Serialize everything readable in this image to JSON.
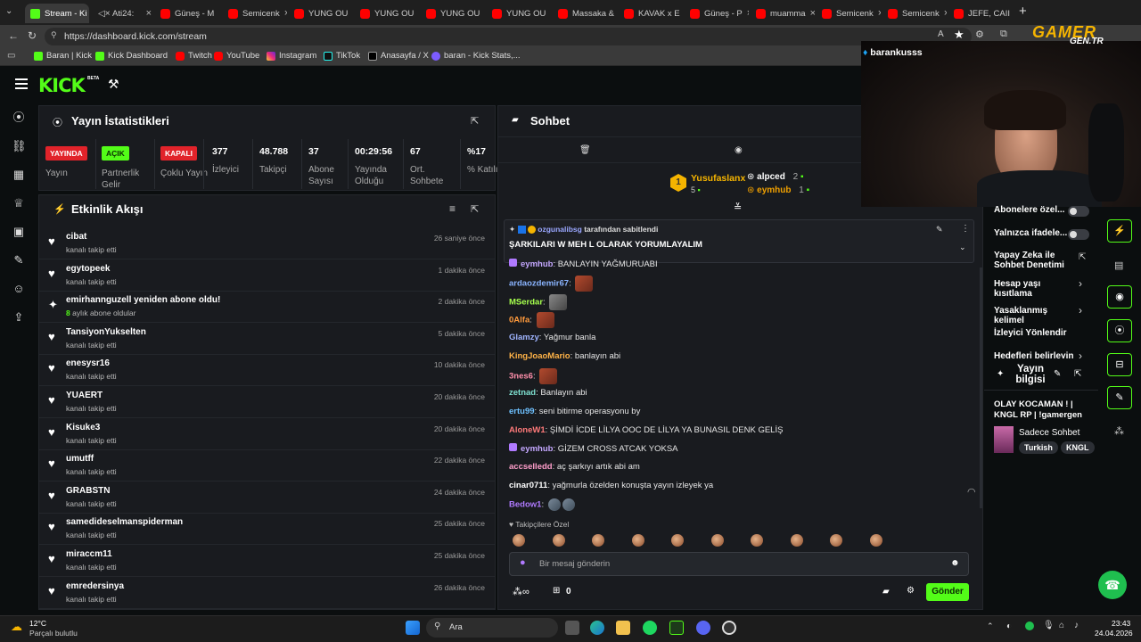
{
  "browser": {
    "tabs": [
      {
        "label": "Stream - Ki",
        "icon": "kick-favicon",
        "active": true
      },
      {
        "label": "Ati24:",
        "icon": "mute-icon"
      },
      {
        "label": "Güneş - M",
        "icon": "youtube-favicon"
      },
      {
        "label": "Semicenk",
        "icon": "youtube-favicon"
      },
      {
        "label": "YUNG OU",
        "icon": "youtube-favicon"
      },
      {
        "label": "YUNG OU",
        "icon": "youtube-favicon"
      },
      {
        "label": "YUNG OU",
        "icon": "youtube-favicon"
      },
      {
        "label": "YUNG OU",
        "icon": "youtube-favicon"
      },
      {
        "label": "Massaka &",
        "icon": "youtube-favicon"
      },
      {
        "label": "KAVAK x E",
        "icon": "youtube-favicon"
      },
      {
        "label": "Güneş - P",
        "icon": "youtube-favicon"
      },
      {
        "label": "muamma",
        "icon": "youtube-favicon"
      },
      {
        "label": "Semicenk",
        "icon": "youtube-favicon"
      },
      {
        "label": "Semicenk",
        "icon": "youtube-favicon"
      },
      {
        "label": "JEFE, CAII",
        "icon": "youtube-favicon"
      }
    ],
    "url": "https://dashboard.kick.com/stream",
    "bookmarks": [
      {
        "label": "Baran | Kick",
        "icon": "kick-favicon"
      },
      {
        "label": "Kick Dashboard",
        "icon": "kick-favicon"
      },
      {
        "label": "Twitch",
        "icon": "youtube-favicon"
      },
      {
        "label": "YouTube",
        "icon": "youtube-favicon"
      },
      {
        "label": "Instagram",
        "icon": "instagram-favicon"
      },
      {
        "label": "TikTok",
        "icon": "tiktok-favicon"
      },
      {
        "label": "Anasayfa / X",
        "icon": "x-favicon"
      },
      {
        "label": "baran - Kick Stats,...",
        "icon": "stats-favicon"
      }
    ]
  },
  "kick": {
    "logo": "KICK",
    "logo_badge": "BETA"
  },
  "stats_panel": {
    "title": "Yayın İstatistikleri",
    "statuses": [
      {
        "badge": "YAYINDA",
        "label": "Yayın",
        "color": "#e1232a"
      },
      {
        "badge": "AÇIK",
        "label": "Partnerlik Gelir",
        "color": "#53fc18"
      },
      {
        "badge": "KAPALI",
        "label": "Çoklu Yayın",
        "color": "#e1232a"
      }
    ],
    "metrics": [
      {
        "value": "377",
        "label": "İzleyici"
      },
      {
        "value": "48.788",
        "label": "Takipçi"
      },
      {
        "value": "37",
        "label": "Abone Sayısı"
      },
      {
        "value": "00:29:56",
        "label": "Yayında Olduğu"
      },
      {
        "value": "67",
        "label": "Ort. Sohbete"
      },
      {
        "value": "%17",
        "label": "% Katılım"
      }
    ]
  },
  "activity": {
    "title": "Etkinlik Akışı",
    "items": [
      {
        "name": "cibat",
        "sub": "kanalı takip etti",
        "time": "26 saniye önce",
        "icon": "heart-icon"
      },
      {
        "name": "egytopeek",
        "sub": "kanalı takip etti",
        "time": "1 dakika önce",
        "icon": "heart-icon"
      },
      {
        "name": "emirhannguzell yeniden abone oldu!",
        "sub_num": "8",
        "sub": "aylık abone oldular",
        "time": "2 dakika önce",
        "icon": "star-icon"
      },
      {
        "name": "TansiyonYukselten",
        "sub": "kanalı takip etti",
        "time": "5 dakika önce",
        "icon": "heart-icon"
      },
      {
        "name": "enesysr16",
        "sub": "kanalı takip etti",
        "time": "10 dakika önce",
        "icon": "heart-icon"
      },
      {
        "name": "YUAERT",
        "sub": "kanalı takip etti",
        "time": "20 dakika önce",
        "icon": "heart-icon"
      },
      {
        "name": "Kisuke3",
        "sub": "kanalı takip etti",
        "time": "20 dakika önce",
        "icon": "heart-icon"
      },
      {
        "name": "umutff",
        "sub": "kanalı takip etti",
        "time": "22 dakika önce",
        "icon": "heart-icon"
      },
      {
        "name": "GRABSTN",
        "sub": "kanalı takip etti",
        "time": "24 dakika önce",
        "icon": "heart-icon"
      },
      {
        "name": "samedideselmanspiderman",
        "sub": "kanalı takip etti",
        "time": "25 dakika önce",
        "icon": "heart-icon"
      },
      {
        "name": "miraccm11",
        "sub": "kanalı takip etti",
        "time": "25 dakika önce",
        "icon": "heart-icon"
      },
      {
        "name": "emredersinya",
        "sub": "kanalı takip etti",
        "time": "26 dakika önce",
        "icon": "heart-icon"
      }
    ]
  },
  "chat": {
    "title": "Sohbet",
    "leaderboard": {
      "first": {
        "rank": "1",
        "name": "Yusufaslanx",
        "count": "5"
      },
      "others": [
        {
          "name": "alpced",
          "count": "2"
        },
        {
          "name": "eymhub",
          "count": "1"
        }
      ]
    },
    "pinned": {
      "by_user": "ozgunalibsg",
      "by_text": "tarafından sabitlendi",
      "text": "ŞARKILARI W MEH L OLARAK YORUMLAYALIM"
    },
    "messages": [
      {
        "user": "eymhub",
        "text": "BANLAYIN YAĞMURUABI",
        "color": "#c4a7ff",
        "emotes": 0
      },
      {
        "user": "ardaozdemir67",
        "text": "",
        "color": "#8ab4ff",
        "emotes": 1
      },
      {
        "user": "MSerdar",
        "text": "",
        "color": "#a6ff4d",
        "emotes": 1
      },
      {
        "user": "0Alfa",
        "text": "",
        "color": "#ff9a3c",
        "emotes": 1
      },
      {
        "user": "Glamzy",
        "text": "Yağmur banla",
        "color": "#9fb4ff",
        "emotes": 0
      },
      {
        "user": "KingJoaoMario",
        "text": "banlayın abi",
        "color": "#ffb347",
        "emotes": 0
      },
      {
        "user": "3nes6",
        "text": "",
        "color": "#ff8fab",
        "emotes": 1
      },
      {
        "user": "zetnad",
        "text": "Banlayın abi",
        "color": "#7ee0d0",
        "emotes": 0
      },
      {
        "user": "ertu99",
        "text": "seni bitirme operasyonu by",
        "color": "#6ec1ff",
        "emotes": 0
      },
      {
        "user": "AloneW1",
        "text": "ŞİMDİ İCDE LİLYA OOC DE LİLYA YA BUNASIL DENK GELİŞ",
        "color": "#ff7a7a",
        "emotes": 0
      },
      {
        "user": "eymhub",
        "text": "GİZEM CROSS ATCAK YOKSA",
        "color": "#c4a7ff",
        "emotes": 0
      },
      {
        "user": "accselledd",
        "text": "aç şarkıyı artık abi am",
        "color": "#ff9ecb",
        "emotes": 0
      },
      {
        "user": "cinar0711",
        "text": "yağmurla özelden konuşta yayın izleyek ya",
        "color": "#ffffff",
        "emotes": 0
      },
      {
        "user": "Bedow1",
        "text": "",
        "color": "#b07aff",
        "emotes": 2
      }
    ],
    "followers_only": "Takipçilere Özel",
    "input_placeholder": "Bir mesaj gönderin",
    "points": "0",
    "send": "Gönder"
  },
  "right_panel": {
    "settings": [
      {
        "label": "Abonelere özel...",
        "toggle": true
      },
      {
        "label": "Yalnızca ifadele...",
        "toggle": true
      },
      {
        "label": "Yapay Zeka ile Sohbet Denetimi",
        "toggle": false
      },
      {
        "label": "Hesap yaşı kısıtlama",
        "toggle": false
      },
      {
        "label": "Yasaklanmış kelimel",
        "toggle": false
      },
      {
        "label": "İzleyici Yönlendir",
        "toggle": false
      },
      {
        "label": "Hedefleri belirleyin",
        "toggle": false
      }
    ],
    "stream_info_title": "Yayın bilgisi",
    "stream_title": "OLAY KOCAMAN ! | KNGL RP | !gamergen",
    "category": "Sadece Sohbet",
    "tags": [
      "Turkish",
      "KNGL"
    ]
  },
  "webcam": {
    "handle": "barankusss",
    "brand": "GAMER",
    "brand_sub": "GEN.TR"
  },
  "taskbar": {
    "temp": "12°C",
    "weather": "Parçalı bulutlu",
    "search": "Ara",
    "time": "23:43",
    "date": "24.04.2026"
  }
}
